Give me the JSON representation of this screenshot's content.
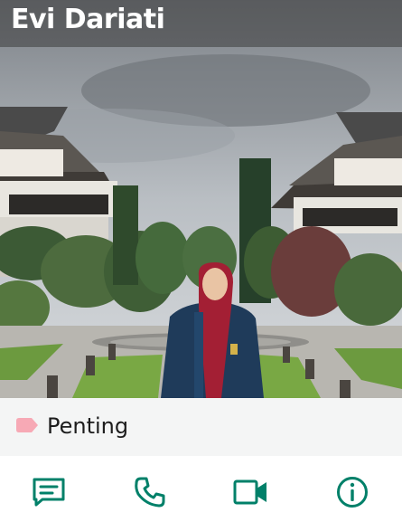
{
  "header": {
    "title": "Evi Dariati"
  },
  "label": {
    "text": "Penting",
    "color": "#f7a9b5"
  },
  "actions": [
    {
      "name": "message",
      "icon": "message-icon"
    },
    {
      "name": "voice-call",
      "icon": "phone-icon"
    },
    {
      "name": "video-call",
      "icon": "video-icon"
    },
    {
      "name": "info",
      "icon": "info-icon"
    }
  ],
  "colors": {
    "accent": "#008069",
    "overlay": "#3c3c3c"
  }
}
